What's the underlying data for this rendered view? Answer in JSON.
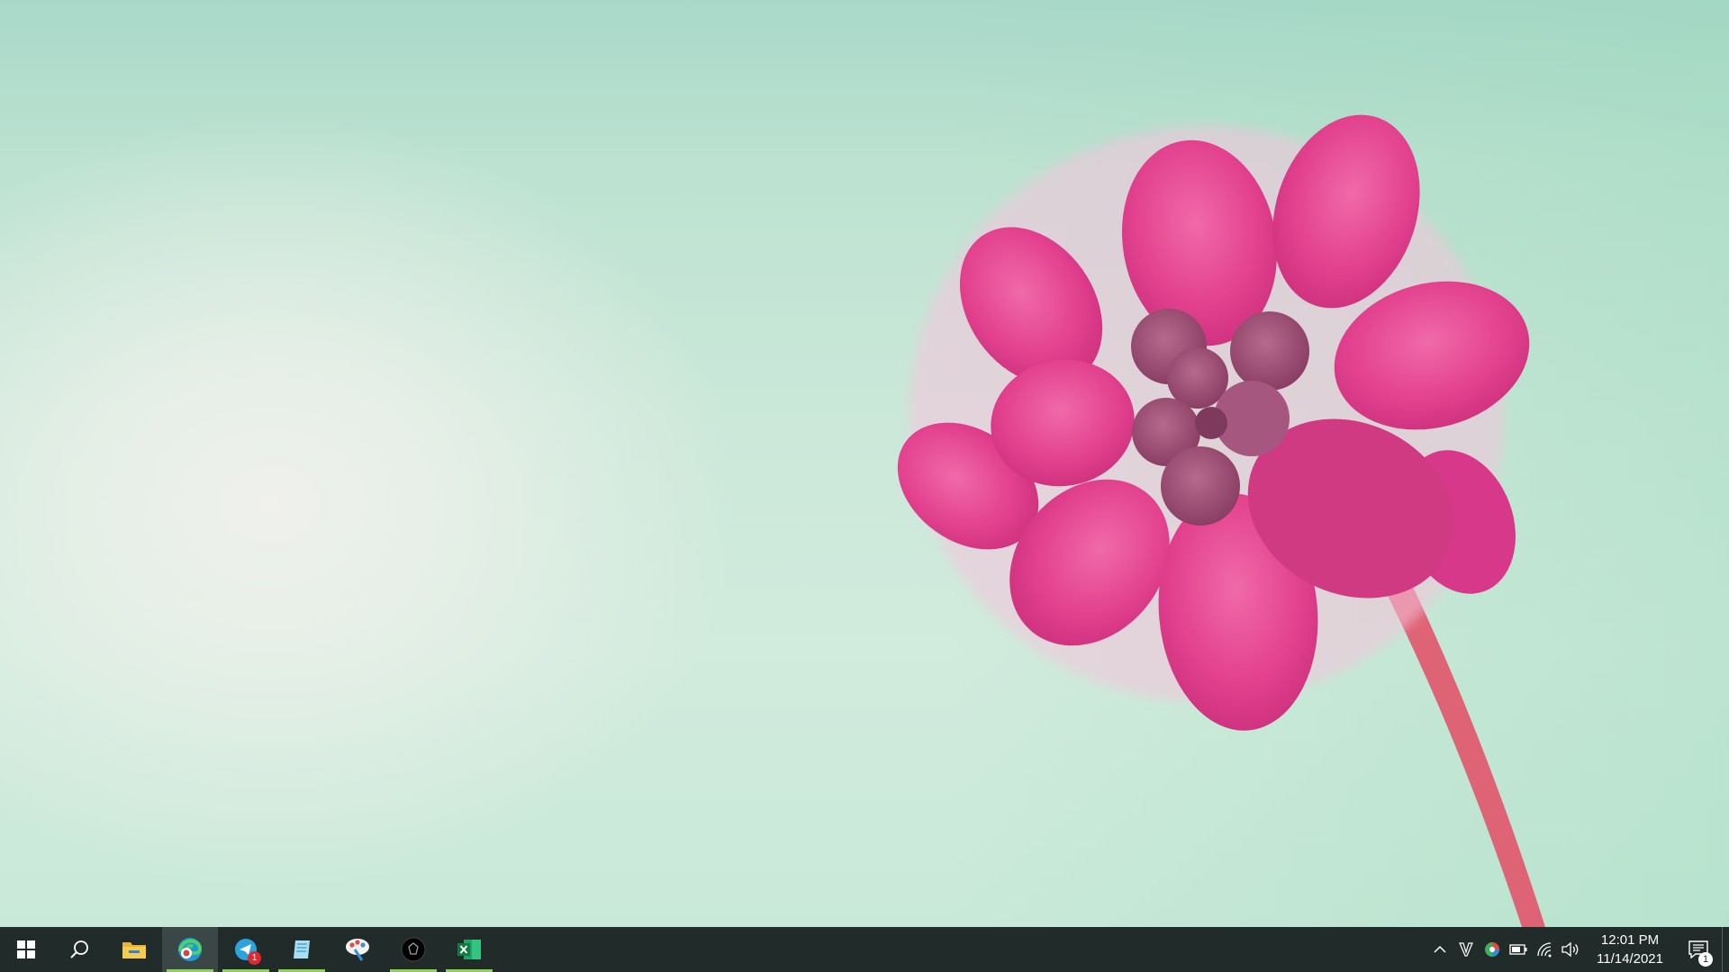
{
  "desktop": {
    "wallpaper": "pink-succulent-flower",
    "colors": {
      "background": "#cbe8d9",
      "petal": "#e3428f",
      "petal_dark": "#c42f78",
      "center": "#9c4a73",
      "stem": "#e0546a"
    }
  },
  "taskbar": {
    "background": "#202b2a",
    "running_indicator": "#8bd35a",
    "apps": [
      {
        "icon": "windows-start-icon",
        "running": false
      },
      {
        "icon": "search-icon",
        "running": false
      },
      {
        "icon": "file-explorer-icon",
        "running": false
      },
      {
        "icon": "edge-browser-icon",
        "running": true,
        "active": true
      },
      {
        "icon": "messaging-app-icon",
        "running": true,
        "badge": "1"
      },
      {
        "icon": "notepad-icon",
        "running": true
      },
      {
        "icon": "paint-icon",
        "running": false
      },
      {
        "icon": "dark-app-icon",
        "running": true
      },
      {
        "icon": "excel-icon",
        "running": true
      }
    ],
    "tray": {
      "icons": [
        "chevron-up-icon",
        "v-app-icon",
        "color-app-icon",
        "battery-icon",
        "wifi-icon",
        "volume-icon"
      ],
      "time": "12:01 PM",
      "date": "11/14/2021",
      "notification_count": "1"
    }
  }
}
